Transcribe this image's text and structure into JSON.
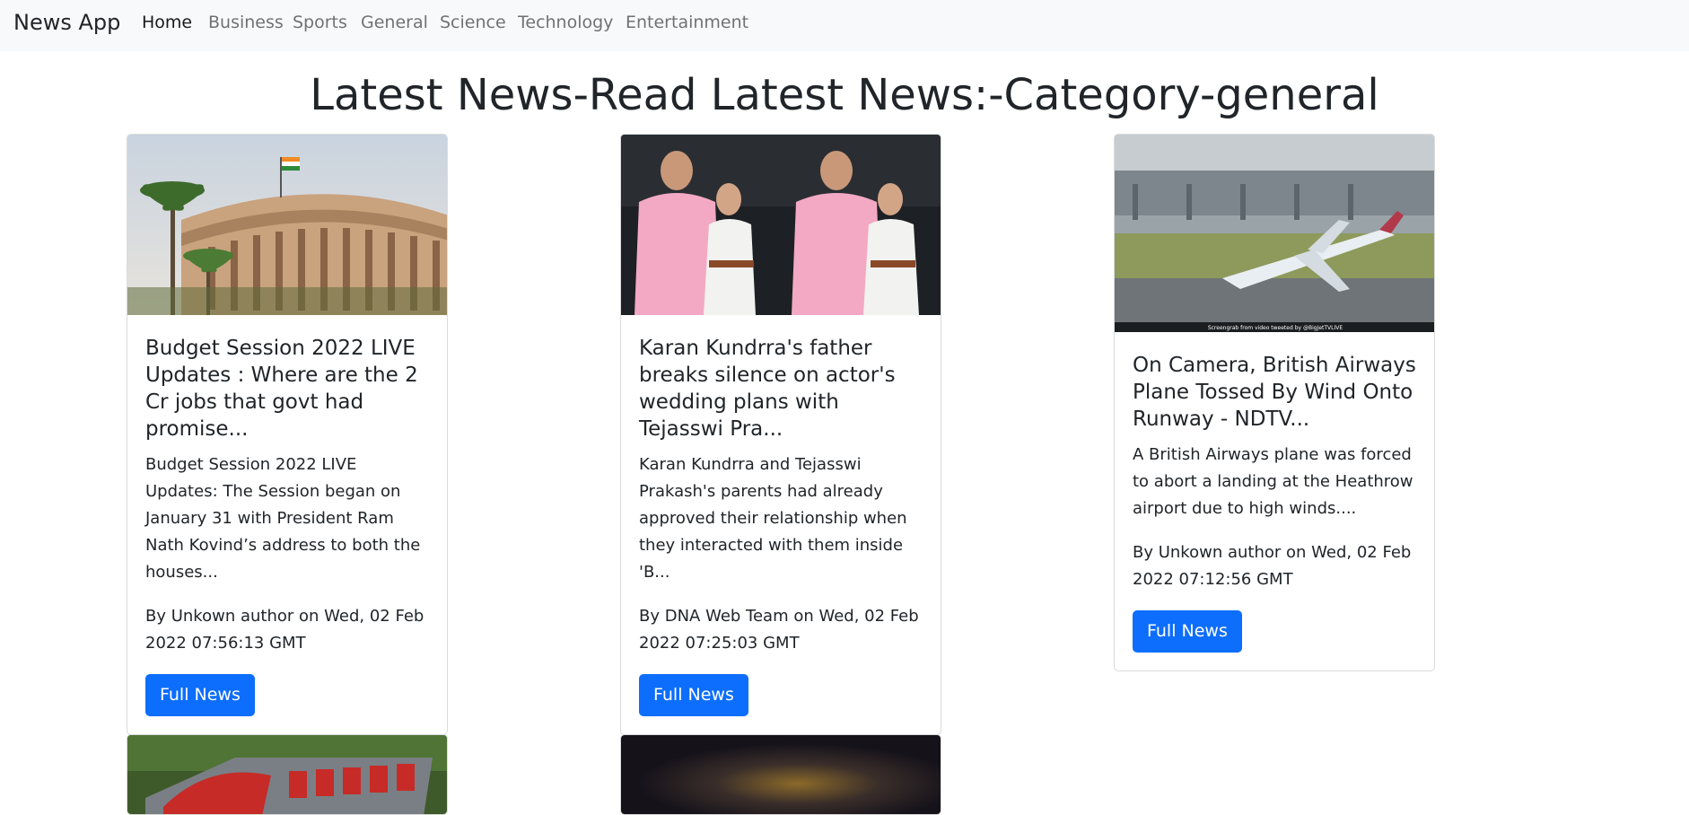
{
  "navbar": {
    "brand": "News App",
    "links": [
      {
        "label": "Home",
        "active": true
      },
      {
        "label": "Business",
        "active": false
      },
      {
        "label": "Sports",
        "active": false
      },
      {
        "label": "General",
        "active": false
      },
      {
        "label": "Science",
        "active": false
      },
      {
        "label": "Technology",
        "active": false
      },
      {
        "label": "Entertainment",
        "active": false
      }
    ]
  },
  "page": {
    "heading": "Latest News-Read Latest News:-Category-general"
  },
  "cards": [
    {
      "image": "parliament-building-photo",
      "title": "Budget Session 2022 LIVE Updates : Where are the 2 Cr jobs that govt had promise...",
      "description": "Budget Session 2022 LIVE Updates: The Session began on January 31 with President Ram Nath Kovind’s address to both the houses...",
      "byline": "By Unkown author on Wed, 02 Feb 2022 07:56:13 GMT",
      "button_label": "Full News"
    },
    {
      "image": "couple-in-pink-and-white-photo",
      "title": "Karan Kundrra's father breaks silence on actor's wedding plans with Tejasswi Pra...",
      "description": "Karan Kundrra and Tejasswi Prakash's parents had already approved their relationship when they interacted with them inside 'B...",
      "byline": "By DNA Web Team on Wed, 02 Feb 2022 07:25:03 GMT",
      "button_label": "Full News"
    },
    {
      "image": "airplane-on-runway-photo",
      "image_caption": "Screengrab from video tweeted by @BigJetTVLIVE",
      "title": "On Camera, British Airways Plane Tossed By Wind Onto Runway - NDTV...",
      "description": "A British Airways plane was forced to abort a landing at the Heathrow airport due to high winds....",
      "byline": "By Unkown author on Wed, 02 Feb 2022 07:12:56 GMT",
      "button_label": "Full News"
    },
    {
      "image": "red-logo-sign-photo"
    },
    {
      "image": "dark-night-photo"
    }
  ]
}
